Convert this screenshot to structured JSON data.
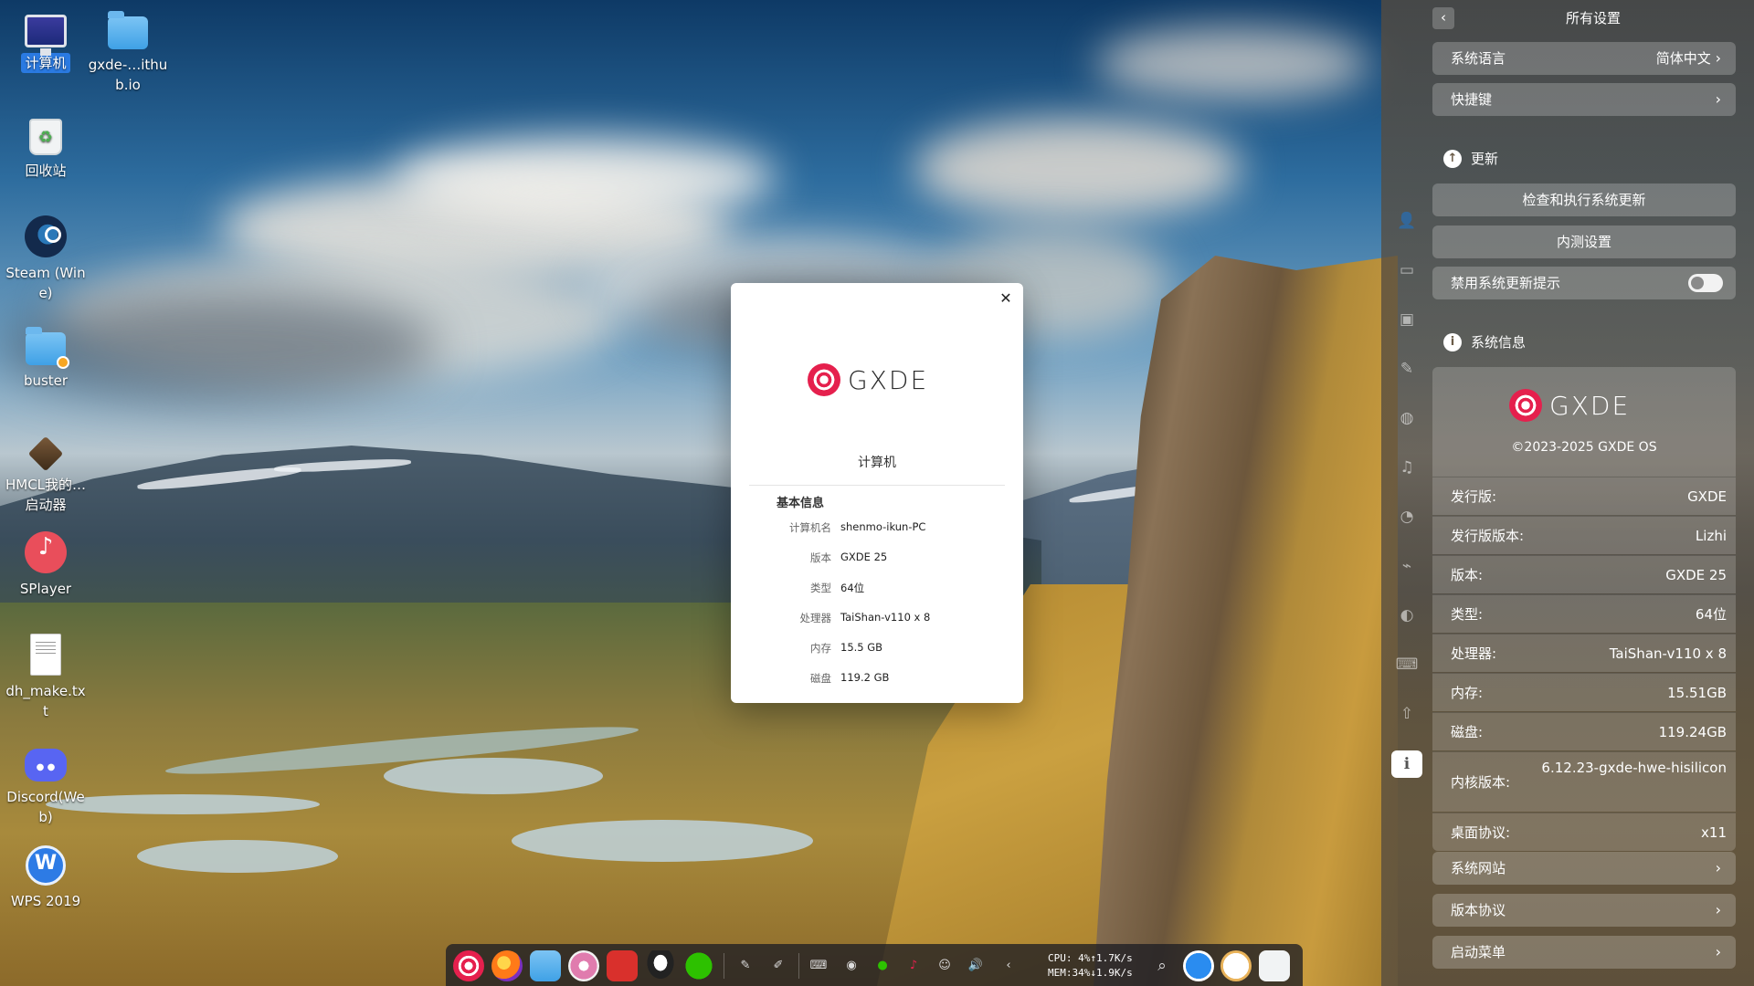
{
  "desktop": {
    "icons": [
      {
        "label": "计算机",
        "icon": "computer-icon"
      },
      {
        "label": "gxde-…ithub.io",
        "icon": "folder-icon"
      },
      {
        "label": "回收站",
        "icon": "trash-icon"
      },
      {
        "label": "Steam (Wine)",
        "icon": "steam-icon"
      },
      {
        "label": "buster",
        "icon": "folder-icon"
      },
      {
        "label": "HMCL我的…启动器",
        "icon": "hmcl-icon"
      },
      {
        "label": "SPlayer",
        "icon": "splayer-icon"
      },
      {
        "label": "dh_make.txt",
        "icon": "text-file-icon"
      },
      {
        "label": "Discord(Web)",
        "icon": "discord-icon"
      },
      {
        "label": "WPS 2019",
        "icon": "wps-icon"
      }
    ]
  },
  "about_dialog": {
    "logo_text": "GXDE",
    "title": "计算机",
    "section": "基本信息",
    "rows": [
      {
        "key": "计算机名",
        "value": "shenmo-ikun-PC"
      },
      {
        "key": "版本",
        "value": "GXDE 25"
      },
      {
        "key": "类型",
        "value": "64位"
      },
      {
        "key": "处理器",
        "value": "TaiShan-v110 x 8"
      },
      {
        "key": "内存",
        "value": "15.5 GB"
      },
      {
        "key": "磁盘",
        "value": "119.2 GB"
      }
    ],
    "close_icon": "close-icon"
  },
  "settings_panel": {
    "title": "所有设置",
    "back_icon": "back-arrow-icon",
    "language_row": {
      "label": "系统语言",
      "value": "简体中文"
    },
    "shortcut_row": {
      "label": "快捷键"
    },
    "update_header": "更新",
    "check_update": "检查和执行系统更新",
    "beta_settings": "内测设置",
    "disable_update_tip": "禁用系统更新提示",
    "disable_update_tip_on": false,
    "sysinfo_header": "系统信息",
    "sysinfo_logo": "GXDE",
    "copyright": "©2023-2025 GXDE OS",
    "info_rows": [
      {
        "key": "发行版:",
        "value": "GXDE"
      },
      {
        "key": "发行版版本:",
        "value": "Lizhi"
      },
      {
        "key": "版本:",
        "value": "GXDE 25"
      },
      {
        "key": "类型:",
        "value": "64位"
      },
      {
        "key": "处理器:",
        "value": "TaiShan-v110 x 8"
      },
      {
        "key": "内存:",
        "value": "15.51GB"
      },
      {
        "key": "磁盘:",
        "value": "119.24GB"
      },
      {
        "key": "内核版本:",
        "value": "6.12.23-gxde-hwe-hisilicon"
      },
      {
        "key": "桌面协议:",
        "value": "x11"
      }
    ],
    "system_website": "系统网站",
    "license": "版本协议",
    "boot_menu": "启动菜单",
    "rail_icons": [
      "account-icon",
      "display-icon",
      "calendar-icon",
      "personalization-icon",
      "network-icon",
      "sound-icon",
      "time-icon",
      "power-icon",
      "mouse-icon",
      "keyboard-icon",
      "update-icon",
      "info-icon"
    ]
  },
  "dock": {
    "apps": [
      "launcher-icon",
      "firefox-icon",
      "file-manager-icon",
      "settings-icon",
      "terminal-icon",
      "qq-icon",
      "wechat-icon"
    ],
    "tray": [
      "pen-icon",
      "pen-icon",
      "keyboard-icon",
      "bluetooth-icon",
      "wechat-icon",
      "music-icon",
      "cat-icon",
      "volume-icon",
      "chevron-left-icon"
    ],
    "cpu_line": "CPU:  4%↑1.7K/s",
    "mem_line": "MEM:34%↓1.9K/s",
    "right_icons": [
      "search-icon",
      "power-icon",
      "clock-icon",
      "trash-icon"
    ]
  }
}
